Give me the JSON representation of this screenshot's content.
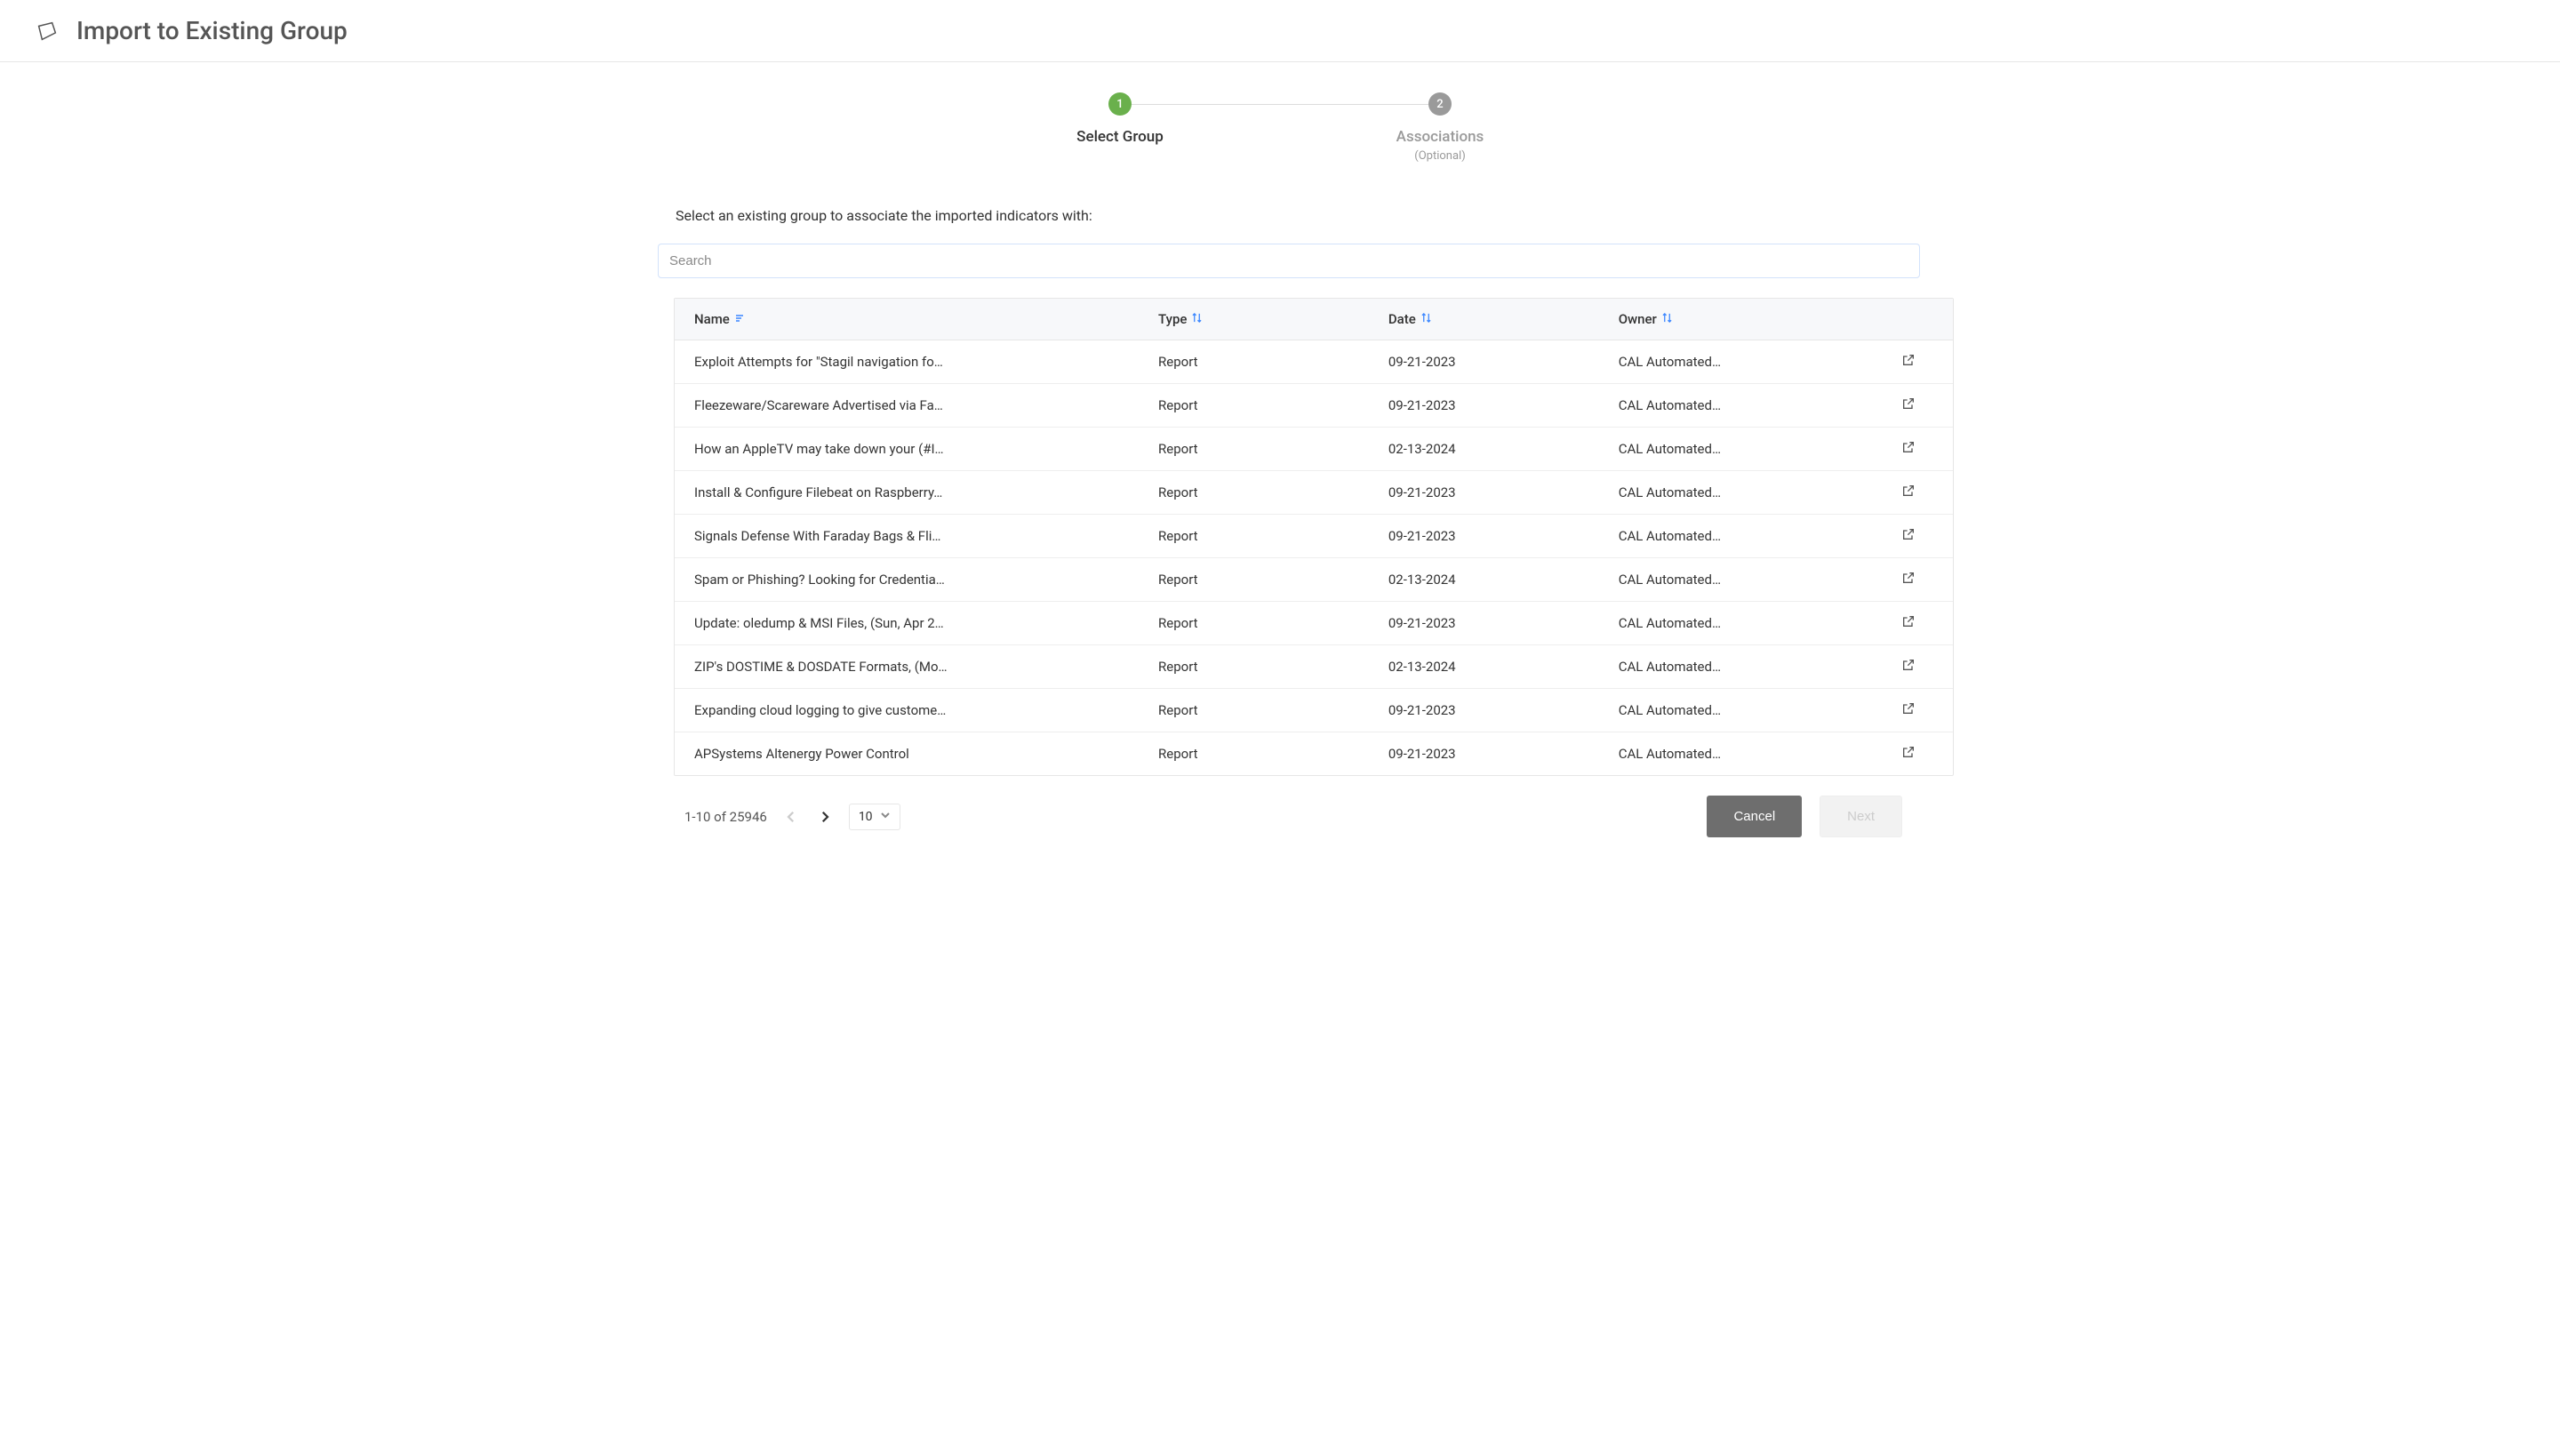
{
  "header": {
    "title": "Import to Existing Group"
  },
  "stepper": {
    "step1": {
      "number": "1",
      "label": "Select Group"
    },
    "step2": {
      "number": "2",
      "label": "Associations",
      "optional": "(Optional)"
    }
  },
  "instruction": "Select an existing group to associate the imported indicators with:",
  "search": {
    "placeholder": "Search"
  },
  "table": {
    "columns": {
      "name": "Name",
      "type": "Type",
      "date": "Date",
      "owner": "Owner"
    },
    "rows": [
      {
        "name": "Exploit Attempts for \"Stagil navigation fo…",
        "type": "Report",
        "date": "09-21-2023",
        "owner": "CAL Automated…"
      },
      {
        "name": "Fleezeware/Scareware Advertised via Fa…",
        "type": "Report",
        "date": "09-21-2023",
        "owner": "CAL Automated…"
      },
      {
        "name": "How an AppleTV may take down your (#I…",
        "type": "Report",
        "date": "02-13-2024",
        "owner": "CAL Automated…"
      },
      {
        "name": "Install & Configure Filebeat on Raspberry…",
        "type": "Report",
        "date": "09-21-2023",
        "owner": "CAL Automated…"
      },
      {
        "name": "Signals Defense With Faraday Bags & Fli…",
        "type": "Report",
        "date": "09-21-2023",
        "owner": "CAL Automated…"
      },
      {
        "name": "Spam or Phishing? Looking for Credentia…",
        "type": "Report",
        "date": "02-13-2024",
        "owner": "CAL Automated…"
      },
      {
        "name": "Update: oledump & MSI Files, (Sun, Apr 2…",
        "type": "Report",
        "date": "09-21-2023",
        "owner": "CAL Automated…"
      },
      {
        "name": "ZIP's DOSTIME & DOSDATE Formats, (Mo…",
        "type": "Report",
        "date": "02-13-2024",
        "owner": "CAL Automated…"
      },
      {
        "name": "Expanding cloud logging to give custome…",
        "type": "Report",
        "date": "09-21-2023",
        "owner": "CAL Automated…"
      },
      {
        "name": "APSystems Altenergy Power Control",
        "type": "Report",
        "date": "09-21-2023",
        "owner": "CAL Automated…"
      }
    ]
  },
  "pagination": {
    "range": "1-10 of 25946",
    "pagesize": "10"
  },
  "buttons": {
    "cancel": "Cancel",
    "next": "Next"
  }
}
